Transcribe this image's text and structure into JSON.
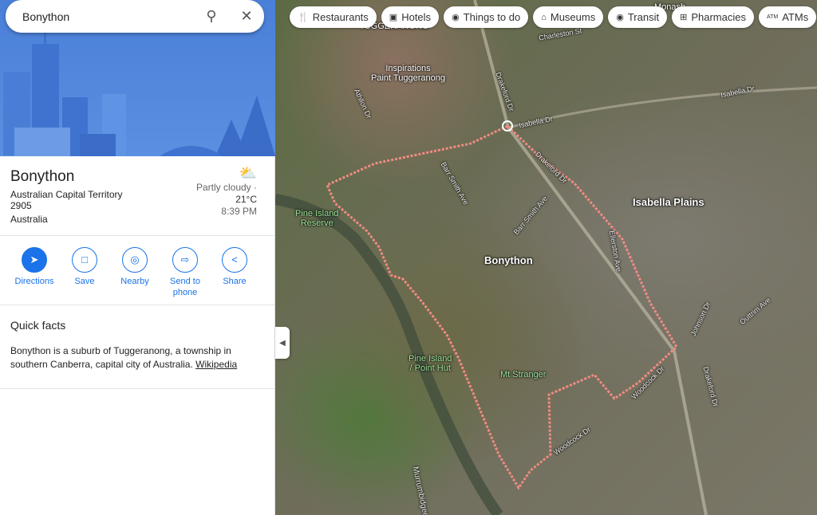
{
  "search": {
    "query": "Bonython"
  },
  "place": {
    "name": "Bonython",
    "address": [
      "Australian Capital Territory",
      "2905",
      "Australia"
    ],
    "weather": {
      "condition": "Partly cloudy ·",
      "temperature": "21°C",
      "time": "8:39 PM"
    }
  },
  "actions": [
    {
      "label": "Directions",
      "icon": "directions-icon"
    },
    {
      "label": "Save",
      "icon": "bookmark-icon"
    },
    {
      "label": "Nearby",
      "icon": "nearby-icon"
    },
    {
      "label": "Send to phone",
      "icon": "send-to-phone-icon"
    },
    {
      "label": "Share",
      "icon": "share-icon"
    }
  ],
  "quick_facts": {
    "heading": "Quick facts",
    "text": "Bonython is a suburb of Tuggeranong, a township in southern Canberra, capital city of Australia.",
    "link": "Wikipedia"
  },
  "chips": [
    {
      "label": "Restaurants",
      "icon": "restaurant-icon"
    },
    {
      "label": "Hotels",
      "icon": "hotel-icon"
    },
    {
      "label": "Things to do",
      "icon": "camera-icon"
    },
    {
      "label": "Museums",
      "icon": "museum-icon"
    },
    {
      "label": "Transit",
      "icon": "transit-icon"
    },
    {
      "label": "Pharmacies",
      "icon": "pharmacy-icon"
    },
    {
      "label": "ATMs",
      "icon": "atm-icon"
    }
  ],
  "map": {
    "labels": {
      "tuggeranong": "TUGGERANONG",
      "inspirations": "Inspirations\nPaint Tuggeranong",
      "isabella_plains": "Isabella Plains",
      "bonython": "Bonython",
      "pine_island_reserve": "Pine Island\nReserve",
      "point_hut": "Pine Island\n/ Point Hut",
      "mt_stranger": "Mt Stranger",
      "river": "Murrumbidgee River",
      "monash": "Monash",
      "drakeford": "Drakeford Dr",
      "isabella_dr": "Isabella Dr",
      "barr_smith": "Barr Smith Ave",
      "ellerston": "Ellerston Ave",
      "johnson": "Johnson Dr",
      "outtrim": "Outtrim Ave",
      "woodcock": "Woodcock Dr",
      "athllon": "Athllon Dr",
      "charleston": "Charleston St"
    },
    "boundary_color": "#f28b82"
  }
}
